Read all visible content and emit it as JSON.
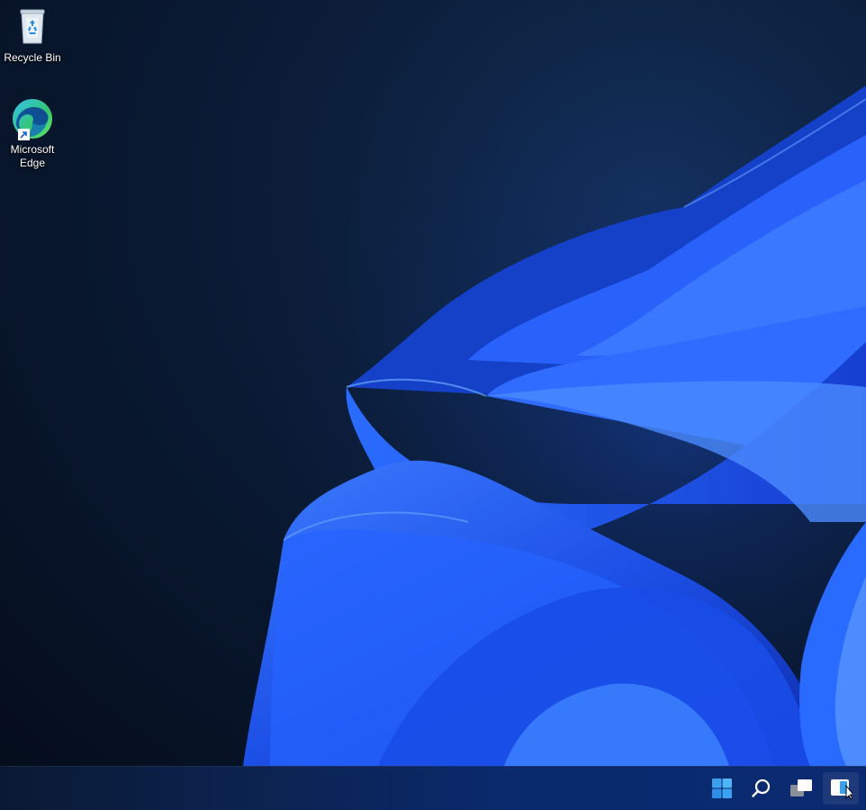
{
  "desktop": {
    "icons": [
      {
        "label": "Recycle Bin",
        "icon": "recycle-bin-icon"
      },
      {
        "label": "Microsoft Edge",
        "icon": "edge-icon"
      }
    ]
  },
  "taskbar": {
    "buttons": [
      {
        "icon": "windows-start-icon"
      },
      {
        "icon": "search-icon"
      },
      {
        "icon": "task-view-icon"
      },
      {
        "icon": "widgets-icon"
      }
    ]
  },
  "colors": {
    "start_blue": "#3aa0f0",
    "wallpaper_blue": "#1f5cf0",
    "desktop_dark": "#071428"
  }
}
